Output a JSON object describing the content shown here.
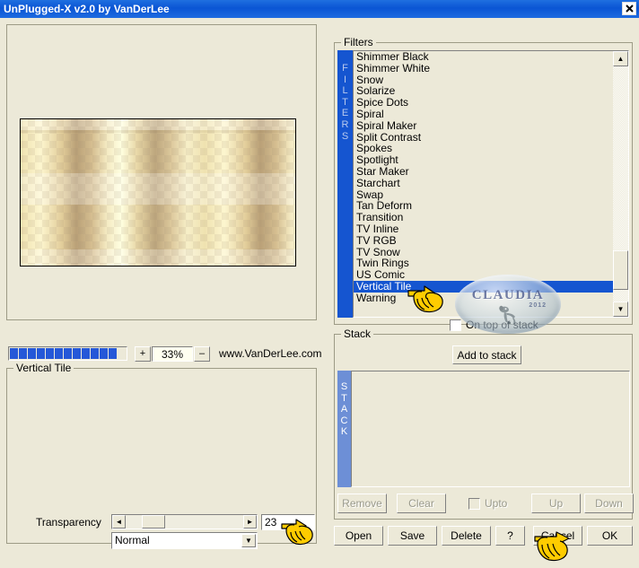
{
  "window": {
    "title": "UnPlugged-X v2.0 by VanDerLee",
    "close_label": "✖"
  },
  "preview": {
    "zoom_value": "33%",
    "zoom_in_label": "+",
    "zoom_out_label": "–",
    "url": "www.VanDerLee.com",
    "progress_blocks": 12,
    "progress_color": "#2558d8"
  },
  "settings": {
    "group_label": "Vertical Tile",
    "transparency_label": "Transparency",
    "transparency_value": "23",
    "slider_left_label": "◄",
    "slider_right_label": "►",
    "blend_mode": "Normal",
    "blend_arrow": "▼"
  },
  "filters": {
    "group_label": "Filters",
    "vertical_label": "FILTERS",
    "selected": "Vertical Tile",
    "items": [
      "Shimmer Black",
      "Shimmer White",
      "Snow",
      "Solarize",
      "Spice Dots",
      "Spiral",
      "Spiral Maker",
      "Split Contrast",
      "Spokes",
      "Spotlight",
      "Star Maker",
      "Starchart",
      "Swap",
      "Tan Deform",
      "Transition",
      "TV Inline",
      "TV RGB",
      "TV Snow",
      "Twin Rings",
      "US Comic",
      "Vertical Tile",
      "Warning"
    ],
    "scroll_up_label": "▲",
    "scroll_down_label": "▼",
    "on_top_label": "On top of stack",
    "on_top_checked": false
  },
  "stack": {
    "group_label": "Stack",
    "vertical_label": "STACK",
    "add_label": "Add to stack",
    "remove_label": "Remove",
    "clear_label": "Clear",
    "upto_label": "Upto",
    "upto_checked": false,
    "up_label": "Up",
    "down_label": "Down",
    "items": []
  },
  "bottom_buttons": {
    "open": "Open",
    "save": "Save",
    "delete": "Delete",
    "help": "?",
    "cancel": "Cancel",
    "ok": "OK"
  },
  "watermark": {
    "text": "CLAUDIA",
    "year": "2012"
  }
}
